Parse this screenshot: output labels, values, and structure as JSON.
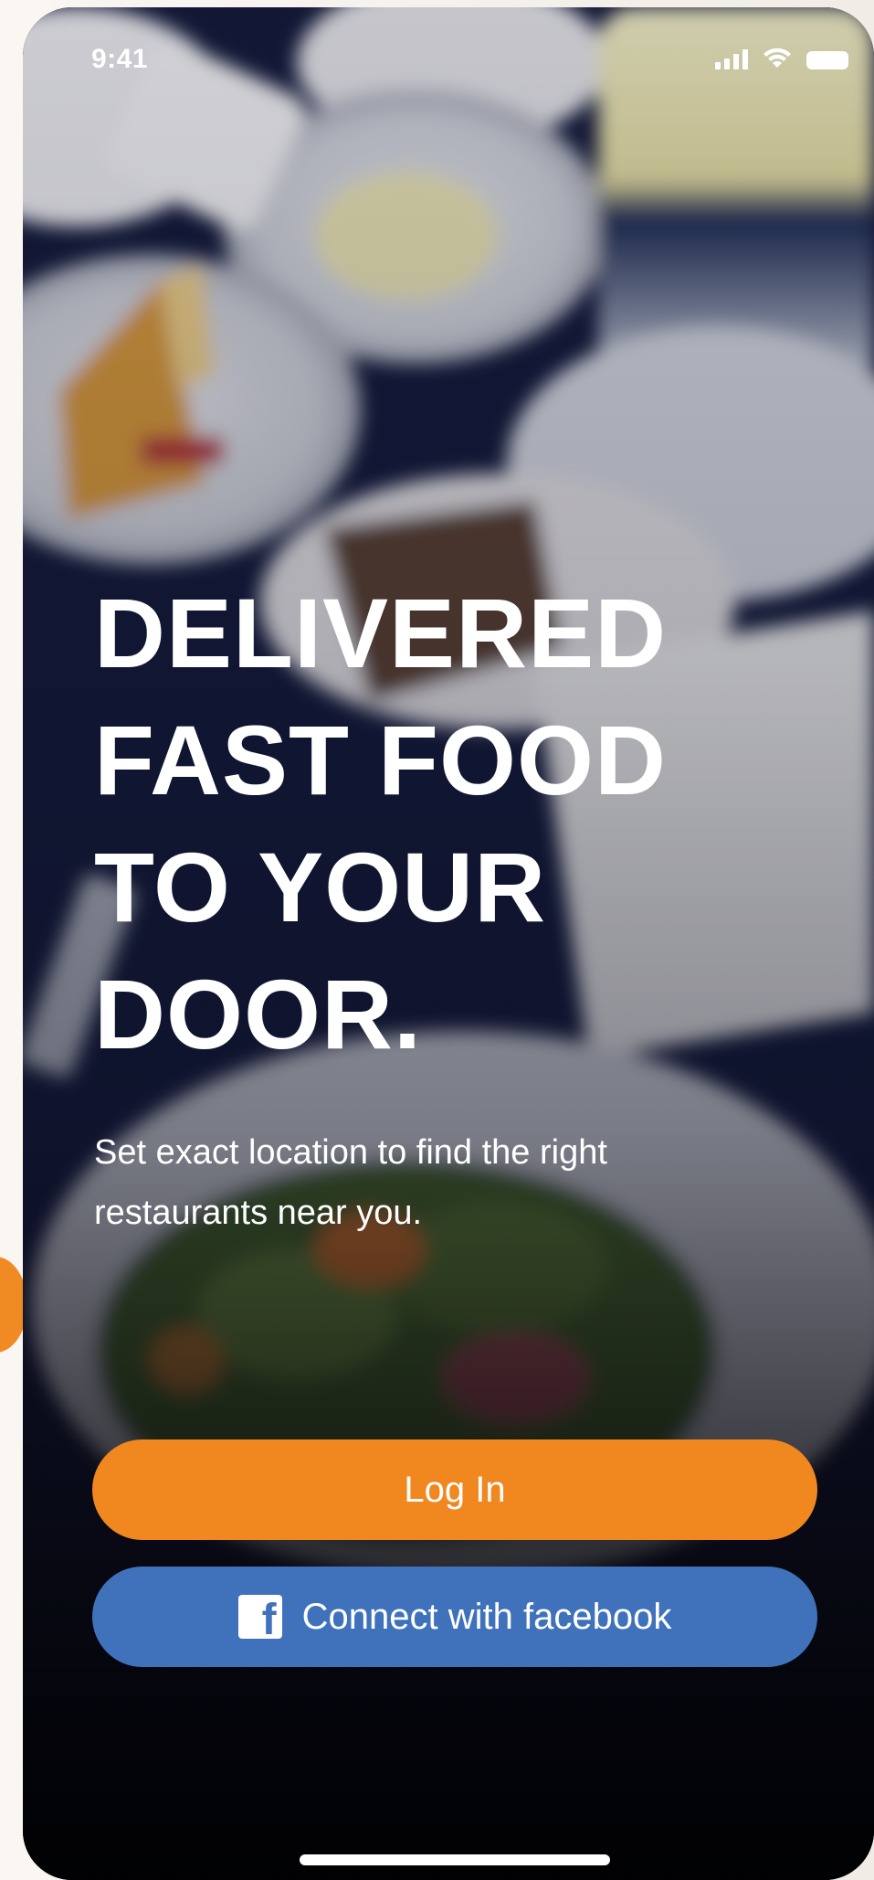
{
  "status_bar": {
    "time": "9:41",
    "signal_icon": "cellular-signal-icon",
    "wifi_icon": "wifi-icon",
    "battery_icon": "battery-icon"
  },
  "hero": {
    "headline_lines": [
      "DELIVERED",
      "FAST FOOD",
      "TO YOUR",
      "DOOR."
    ],
    "subtitle_line1": "Set exact location to find the right",
    "subtitle_line2": "restaurants near you."
  },
  "actions": {
    "login_label": "Log In",
    "facebook_label": "Connect with facebook",
    "facebook_icon": "facebook-icon"
  },
  "colors": {
    "login_button": "#f0871f",
    "facebook_button": "#3f72bb",
    "text": "#ffffff"
  }
}
